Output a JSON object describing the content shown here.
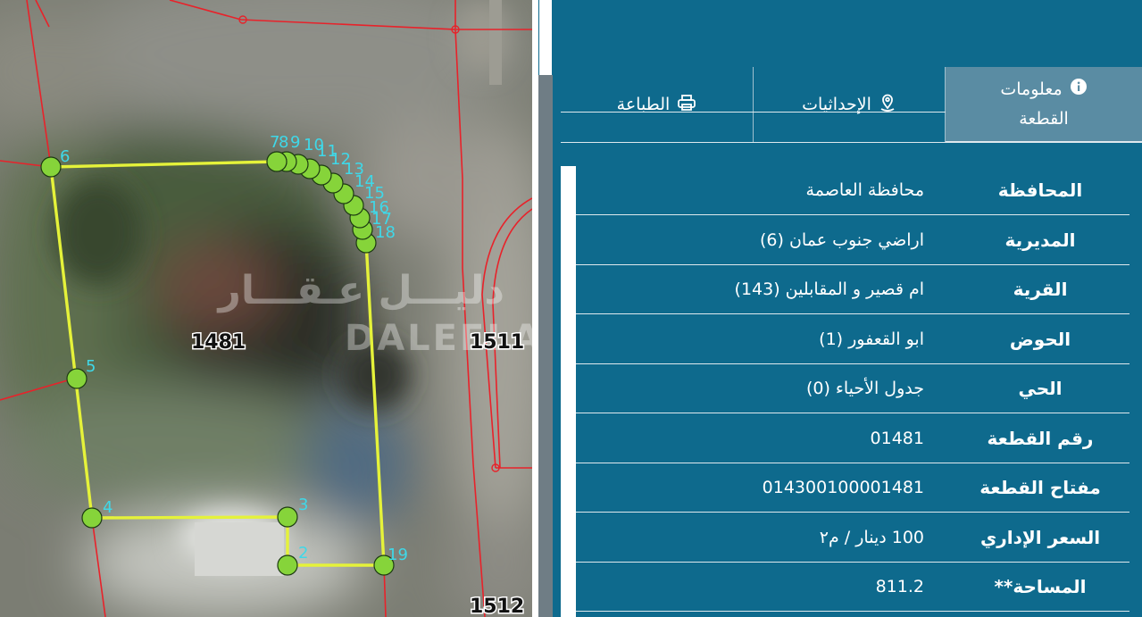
{
  "map": {
    "parcels": [
      {
        "name": "parcel-1481",
        "label": "1481"
      },
      {
        "name": "parcel-1511",
        "label": "1511"
      },
      {
        "name": "parcel-1512",
        "label": "1512"
      }
    ],
    "vertices": [
      {
        "label": "6"
      },
      {
        "label": "5"
      },
      {
        "label": "4"
      },
      {
        "label": "3"
      },
      {
        "label": "2"
      },
      {
        "label": "19"
      },
      {
        "label": "18"
      },
      {
        "label": "17"
      },
      {
        "label": "16"
      },
      {
        "label": "15"
      },
      {
        "label": "14"
      },
      {
        "label": "13"
      },
      {
        "label": "12"
      },
      {
        "label": "11"
      },
      {
        "label": "10"
      },
      {
        "label": "9"
      },
      {
        "label": "8"
      },
      {
        "label": "7"
      }
    ],
    "watermark": {
      "arabic": "دليـــل عـقـــار",
      "latin": "DALEELAQAR"
    }
  },
  "tabs": {
    "info": {
      "line1": "معلومات",
      "line2": "القطعة",
      "icon": "info-circle-icon"
    },
    "coords": {
      "label": "الإحداثيات",
      "icon": "map-pin-icon"
    },
    "print": {
      "label": "الطباعة",
      "icon": "printer-icon"
    }
  },
  "details": [
    {
      "key": "المحافظة",
      "value": "محافظة العاصمة"
    },
    {
      "key": "المديرية",
      "value": "اراضي جنوب عمان (6)"
    },
    {
      "key": "القرية",
      "value": "ام قصير و المقابلين (143)"
    },
    {
      "key": "الحوض",
      "value": "ابو القعفور (1)"
    },
    {
      "key": "الحي",
      "value": "جدول الأحياء (0)"
    },
    {
      "key": "رقم القطعة",
      "value": "01481"
    },
    {
      "key": "مفتاح القطعة",
      "value": "014300100001481"
    },
    {
      "key": "السعر الإداري",
      "value": "100 دينار / م٢"
    },
    {
      "key": "المساحة**",
      "value": "811.2"
    }
  ],
  "colors": {
    "panel": "#0e6a8d",
    "active_tab": "#5a8ca3",
    "boundary": "#e5f23a",
    "vertex": "#86d43a",
    "vertex_label": "#3fd8e8",
    "cadastral_line": "#e8222a"
  }
}
